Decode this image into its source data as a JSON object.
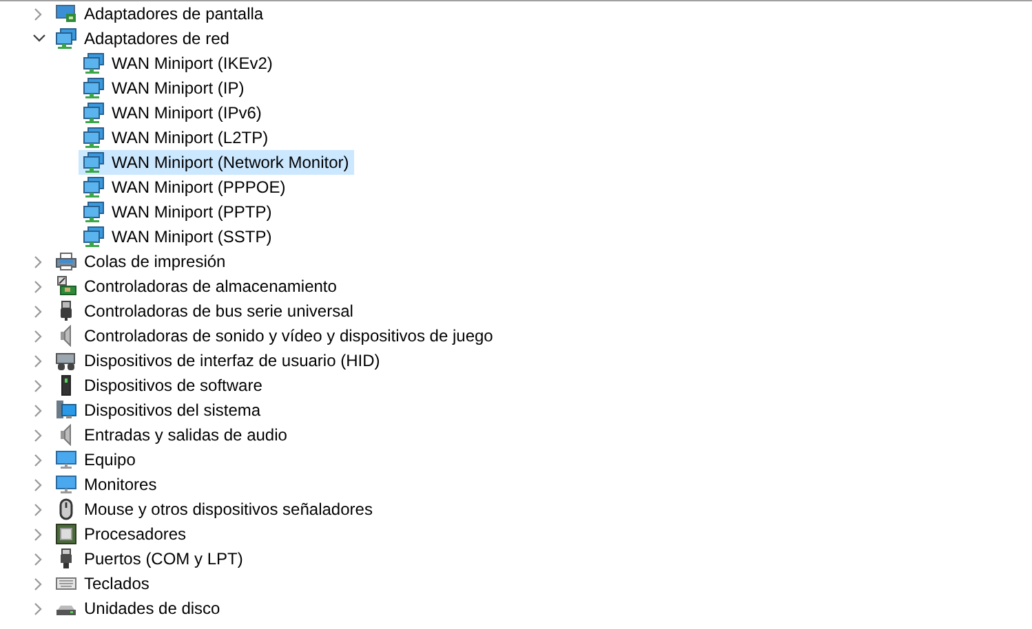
{
  "tree": {
    "items": [
      {
        "label": "Adaptadores de pantalla",
        "kind": "display",
        "expanded": false,
        "selected": false
      },
      {
        "label": "Adaptadores de red",
        "kind": "network",
        "expanded": true,
        "selected": false,
        "children": [
          {
            "label": "WAN Miniport (IKEv2)",
            "kind": "network",
            "selected": false
          },
          {
            "label": "WAN Miniport (IP)",
            "kind": "network",
            "selected": false
          },
          {
            "label": "WAN Miniport (IPv6)",
            "kind": "network",
            "selected": false
          },
          {
            "label": "WAN Miniport (L2TP)",
            "kind": "network",
            "selected": false
          },
          {
            "label": "WAN Miniport (Network Monitor)",
            "kind": "network",
            "selected": true
          },
          {
            "label": "WAN Miniport (PPPOE)",
            "kind": "network",
            "selected": false
          },
          {
            "label": "WAN Miniport (PPTP)",
            "kind": "network",
            "selected": false
          },
          {
            "label": "WAN Miniport (SSTP)",
            "kind": "network",
            "selected": false
          }
        ]
      },
      {
        "label": "Colas de impresión",
        "kind": "printer",
        "expanded": false,
        "selected": false
      },
      {
        "label": "Controladoras de almacenamiento",
        "kind": "storage",
        "expanded": false,
        "selected": false
      },
      {
        "label": "Controladoras de bus serie universal",
        "kind": "usb",
        "expanded": false,
        "selected": false
      },
      {
        "label": "Controladoras de sonido y vídeo y dispositivos de juego",
        "kind": "speaker",
        "expanded": false,
        "selected": false
      },
      {
        "label": "Dispositivos de interfaz de usuario (HID)",
        "kind": "hid",
        "expanded": false,
        "selected": false
      },
      {
        "label": "Dispositivos de software",
        "kind": "software",
        "expanded": false,
        "selected": false
      },
      {
        "label": "Dispositivos del sistema",
        "kind": "system",
        "expanded": false,
        "selected": false
      },
      {
        "label": "Entradas y salidas de audio",
        "kind": "speaker",
        "expanded": false,
        "selected": false
      },
      {
        "label": "Equipo",
        "kind": "monitor",
        "expanded": false,
        "selected": false
      },
      {
        "label": "Monitores",
        "kind": "monitor",
        "expanded": false,
        "selected": false
      },
      {
        "label": "Mouse y otros dispositivos señaladores",
        "kind": "mouse",
        "expanded": false,
        "selected": false
      },
      {
        "label": "Procesadores",
        "kind": "cpu",
        "expanded": false,
        "selected": false
      },
      {
        "label": "Puertos (COM y LPT)",
        "kind": "port",
        "expanded": false,
        "selected": false
      },
      {
        "label": "Teclados",
        "kind": "keyboard",
        "expanded": false,
        "selected": false
      },
      {
        "label": "Unidades de disco",
        "kind": "disk",
        "expanded": false,
        "selected": false
      }
    ]
  }
}
